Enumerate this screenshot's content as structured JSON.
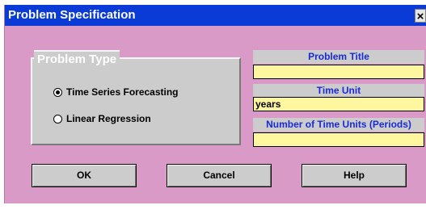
{
  "window": {
    "title": "Problem Specification",
    "close_label": "×"
  },
  "problem_type": {
    "legend": "Problem Type",
    "options": [
      {
        "label": "Time Series Forecasting",
        "selected": true
      },
      {
        "label": "Linear Regression",
        "selected": false
      }
    ]
  },
  "fields": {
    "problem_title": {
      "label": "Problem Title",
      "value": ""
    },
    "time_unit": {
      "label": "Time Unit",
      "value": "years"
    },
    "num_units": {
      "label": "Number of Time Units (Periods)",
      "value": ""
    }
  },
  "buttons": {
    "ok": "OK",
    "cancel": "Cancel",
    "help": "Help"
  },
  "colors": {
    "titlebar": "#0a3bd6",
    "client": "#d99ac8",
    "field_bg": "#fff6a0",
    "label_text": "#1a2bd6"
  }
}
